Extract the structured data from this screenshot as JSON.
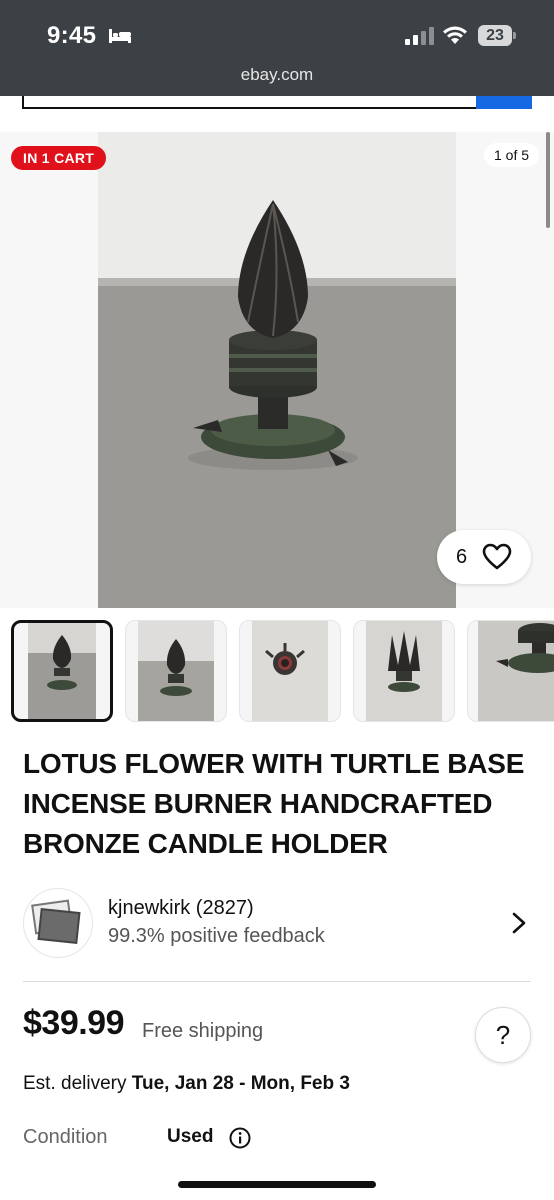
{
  "status_bar": {
    "time": "9:45",
    "battery": "23"
  },
  "browser": {
    "url": "ebay.com"
  },
  "gallery": {
    "cart_badge": "IN 1 CART",
    "counter": "1 of 5",
    "watch_count": "6",
    "thumbnail_count": 5,
    "active_thumbnail": 1
  },
  "listing": {
    "title": "LOTUS FLOWER WITH TURTLE BASE INCENSE BURNER HANDCRAFTED BRONZE CANDLE HOLDER"
  },
  "seller": {
    "name": "kjnewkirk (2827)",
    "feedback": "99.3% positive feedback"
  },
  "pricing": {
    "price": "$39.99",
    "shipping": "Free shipping",
    "help": "?"
  },
  "delivery": {
    "label": "Est. delivery",
    "dates": "Tue, Jan 28 - Mon, Feb 3"
  },
  "condition": {
    "label": "Condition",
    "value": "Used"
  },
  "icons": [
    "bed-icon",
    "signal-icon",
    "wifi-icon",
    "heart-icon",
    "chevron-right-icon",
    "info-icon"
  ],
  "colors": {
    "cart_badge": "#e0111b",
    "chrome": "#3b4145",
    "accent_blue": "#1668e3"
  }
}
